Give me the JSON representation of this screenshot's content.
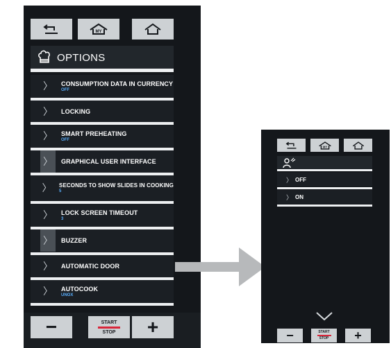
{
  "left_screen": {
    "header": {
      "title": "OPTIONS",
      "icon": "chef-hat-icon"
    },
    "top_buttons": [
      {
        "name": "back",
        "icon": "back-arrow-icon"
      },
      {
        "name": "my-home",
        "label": "MY",
        "icon": "my-home-icon"
      },
      {
        "name": "home",
        "icon": "home-icon"
      }
    ],
    "items": [
      {
        "label": "CONSUMPTION DATA IN CURRENCY",
        "value": "OFF"
      },
      {
        "label": "LOCKING",
        "value": ""
      },
      {
        "label": "SMART PREHEATING",
        "value": "OFF"
      },
      {
        "label": "GRAPHICAL USER INTERFACE",
        "value": ""
      },
      {
        "label": "SECONDS TO SHOW SLIDES IN COOKING",
        "value": "5"
      },
      {
        "label": "LOCK SCREEN TIMEOUT",
        "value": "3"
      },
      {
        "label": "BUZZER",
        "value": ""
      },
      {
        "label": "AUTOMATIC DOOR",
        "value": ""
      },
      {
        "label": "AUTOCOOK",
        "value": "UNOX"
      }
    ],
    "bottom": {
      "minus": "−",
      "start": "START",
      "stop": "STOP",
      "plus": "+"
    }
  },
  "right_screen": {
    "header_icon": "person-wave-icon",
    "top_buttons": [
      {
        "name": "back",
        "icon": "back-arrow-icon"
      },
      {
        "name": "my-home",
        "label": "MY",
        "icon": "my-home-icon"
      },
      {
        "name": "home",
        "icon": "home-icon"
      }
    ],
    "items": [
      {
        "label": "OFF"
      },
      {
        "label": "ON"
      }
    ],
    "bottom": {
      "minus": "−",
      "start": "START",
      "stop": "STOP",
      "plus": "+"
    }
  },
  "colors": {
    "panel": "#14171b",
    "item": "#1b1f24",
    "separator": "#eef0f2",
    "button": "#cdd1d4",
    "value_blue": "#5ab0ff",
    "stop_red": "#d9263a",
    "arrow": "#b7b9bb"
  }
}
